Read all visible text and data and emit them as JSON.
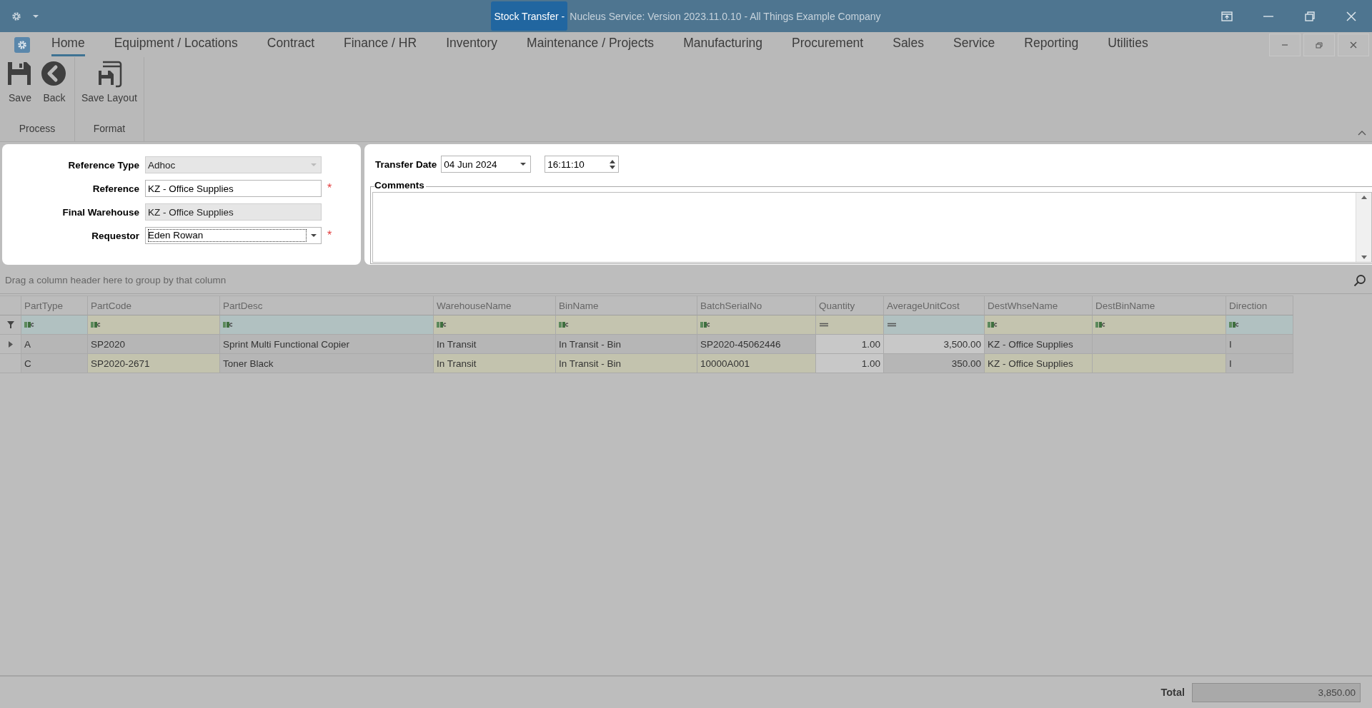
{
  "title_bar": {
    "document": "Stock Transfer -",
    "title": "Nucleus Service: Version 2023.11.0.10 - All Things Example Company"
  },
  "menu": [
    {
      "label": "Home",
      "selected": true
    },
    {
      "label": "Equipment / Locations",
      "selected": false
    },
    {
      "label": "Contract",
      "selected": false
    },
    {
      "label": "Finance / HR",
      "selected": false
    },
    {
      "label": "Inventory",
      "selected": false
    },
    {
      "label": "Maintenance / Projects",
      "selected": false
    },
    {
      "label": "Manufacturing",
      "selected": false
    },
    {
      "label": "Procurement",
      "selected": false
    },
    {
      "label": "Sales",
      "selected": false
    },
    {
      "label": "Service",
      "selected": false
    },
    {
      "label": "Reporting",
      "selected": false
    },
    {
      "label": "Utilities",
      "selected": false
    }
  ],
  "ribbon": {
    "groups": [
      {
        "label": "Process",
        "buttons": [
          {
            "label": "Save",
            "kind": "save"
          },
          {
            "label": "Back",
            "kind": "back"
          }
        ]
      },
      {
        "label": "Format",
        "buttons": [
          {
            "label": "Save Layout",
            "kind": "layout"
          }
        ]
      }
    ]
  },
  "form": {
    "fields": [
      {
        "label": "Reference Type",
        "value": "Adhoc",
        "kind": "dropdown",
        "disabled": true
      },
      {
        "label": "Reference",
        "value": "KZ - Office Supplies",
        "kind": "text",
        "disabled": false,
        "required_mark": "*"
      },
      {
        "label": "Final Warehouse",
        "value": "KZ - Office Supplies",
        "kind": "text",
        "disabled": true
      },
      {
        "label": "Requestor",
        "value": "Eden Rowan",
        "kind": "dropdown",
        "disabled": false,
        "required_mark": "*"
      }
    ],
    "transfer_date_label": "Transfer Date",
    "transfer_date": "04 Jun 2024",
    "transfer_time": "16:11:10",
    "comments_label": "Comments"
  },
  "grid": {
    "group_hint": "Drag a column header here to group by that column",
    "columns": [
      {
        "label": "PartType",
        "kind": "text"
      },
      {
        "label": "PartCode",
        "kind": "text"
      },
      {
        "label": "PartDesc",
        "kind": "text"
      },
      {
        "label": "WarehouseName",
        "kind": "text"
      },
      {
        "label": "BinName",
        "kind": "text"
      },
      {
        "label": "BatchSerialNo",
        "kind": "text"
      },
      {
        "label": "Quantity",
        "kind": "number"
      },
      {
        "label": "AverageUnitCost",
        "kind": "number"
      },
      {
        "label": "DestWhseName",
        "kind": "text"
      },
      {
        "label": "DestBinName",
        "kind": "text"
      },
      {
        "label": "Direction",
        "kind": "text"
      }
    ],
    "rows": [
      {
        "selected": true,
        "cells": [
          "A",
          "SP2020",
          "Sprint Multi Functional Copier",
          "In Transit",
          "In Transit - Bin",
          "SP2020-45062446",
          "1.00",
          "3,500.00",
          "KZ - Office Supplies",
          "",
          "I"
        ]
      },
      {
        "selected": false,
        "cells": [
          "C",
          "SP2020-2671",
          "Toner Black",
          "In Transit",
          "In Transit - Bin",
          "10000A001",
          "1.00",
          "350.00",
          "KZ - Office Supplies",
          "",
          "I"
        ]
      }
    ]
  },
  "footer": {
    "total_label": "Total",
    "total": "3,850.00"
  }
}
